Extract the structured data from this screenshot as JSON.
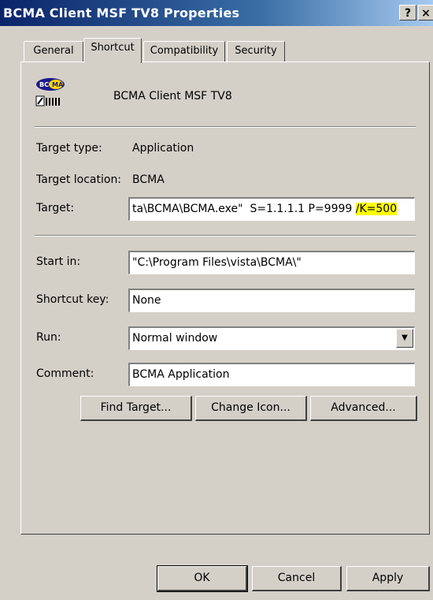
{
  "window": {
    "title": "BCMA Client MSF TV8 Properties",
    "help_label": "?",
    "close_label": "×"
  },
  "tabs": [
    {
      "label": "General"
    },
    {
      "label": "Shortcut"
    },
    {
      "label": "Compatibility"
    },
    {
      "label": "Security"
    }
  ],
  "shortcut": {
    "name": "BCMA Client MSF TV8",
    "target_type_label": "Target type:",
    "target_type_value": "Application",
    "target_location_label": "Target location:",
    "target_location_value": "BCMA",
    "target_label": "Target:",
    "target_value_main": "ta\\BCMA\\BCMA.exe\"  S=1.1.1.1 P=9999 ",
    "target_value_highlight": "/K=500",
    "start_in_label": "Start in:",
    "start_in_value": "\"C:\\Program Files\\vista\\BCMA\\\"",
    "shortcut_key_label": "Shortcut key:",
    "shortcut_key_value": "None",
    "run_label": "Run:",
    "run_value": "Normal window",
    "comment_label": "Comment:",
    "comment_value": "BCMA Application"
  },
  "buttons": {
    "find_target": "Find Target...",
    "change_icon": "Change Icon...",
    "advanced": "Advanced...",
    "ok": "OK",
    "cancel": "Cancel",
    "apply": "Apply"
  },
  "icon": {
    "name": "bcma-app-icon",
    "badge_text": "BCMA",
    "accent": "#1a1a8c",
    "yellow": "#ffd800"
  }
}
